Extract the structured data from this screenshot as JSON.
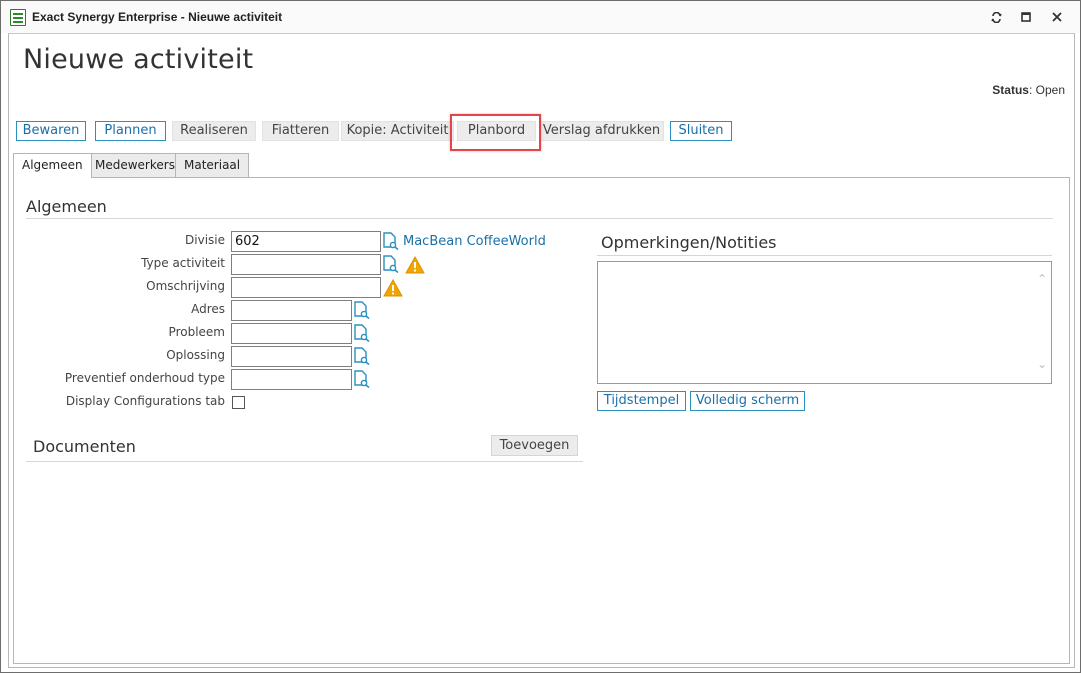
{
  "window": {
    "title": "Exact Synergy Enterprise - Nieuwe activiteit",
    "icons": [
      "app-icon",
      "restore-icon",
      "maximize-icon",
      "close-icon"
    ]
  },
  "page": {
    "title": "Nieuwe activiteit",
    "status_label": "Status",
    "status_value": "Open"
  },
  "toolbar": {
    "buttons": [
      {
        "label": "Bewaren",
        "style": "primary"
      },
      {
        "label": "Plannen",
        "style": "primary"
      },
      {
        "label": "Realiseren",
        "style": "secondary"
      },
      {
        "label": "Fiatteren",
        "style": "secondary"
      },
      {
        "label": "Kopie: Activiteit",
        "style": "secondary"
      },
      {
        "label": "Planbord",
        "style": "secondary",
        "highlighted": true
      },
      {
        "label": "Verslag afdrukken",
        "style": "secondary"
      },
      {
        "label": "Sluiten",
        "style": "primary"
      }
    ],
    "highlight_color": "#e0474c"
  },
  "tabs": [
    {
      "label": "Algemeen",
      "active": true
    },
    {
      "label": "Medewerkers",
      "active": false
    },
    {
      "label": "Materiaal",
      "active": false
    }
  ],
  "algemeen": {
    "title": "Algemeen",
    "fields": [
      {
        "label": "Divisie",
        "value": "602",
        "link": "MacBean CoffeeWorld"
      },
      {
        "label": "Type activiteit",
        "value": "",
        "warning": true
      },
      {
        "label": "Omschrijving",
        "value": "",
        "warning": true
      },
      {
        "label": "Adres",
        "value": ""
      },
      {
        "label": "Probleem",
        "value": ""
      },
      {
        "label": "Oplossing",
        "value": ""
      },
      {
        "label": "Preventief onderhoud type",
        "value": ""
      }
    ],
    "checkbox_label": "Display Configurations tab",
    "checkbox_checked": false
  },
  "notes": {
    "title": "Opmerkingen/Notities",
    "value": "",
    "timestamp_button": "Tijdstempel",
    "fullscreen_button": "Volledig scherm"
  },
  "documents": {
    "title": "Documenten",
    "add_button": "Toevoegen"
  },
  "colors": {
    "accent": "#1a6fa8",
    "button_border": "#2b8fc0",
    "warning": "#f0a500"
  }
}
